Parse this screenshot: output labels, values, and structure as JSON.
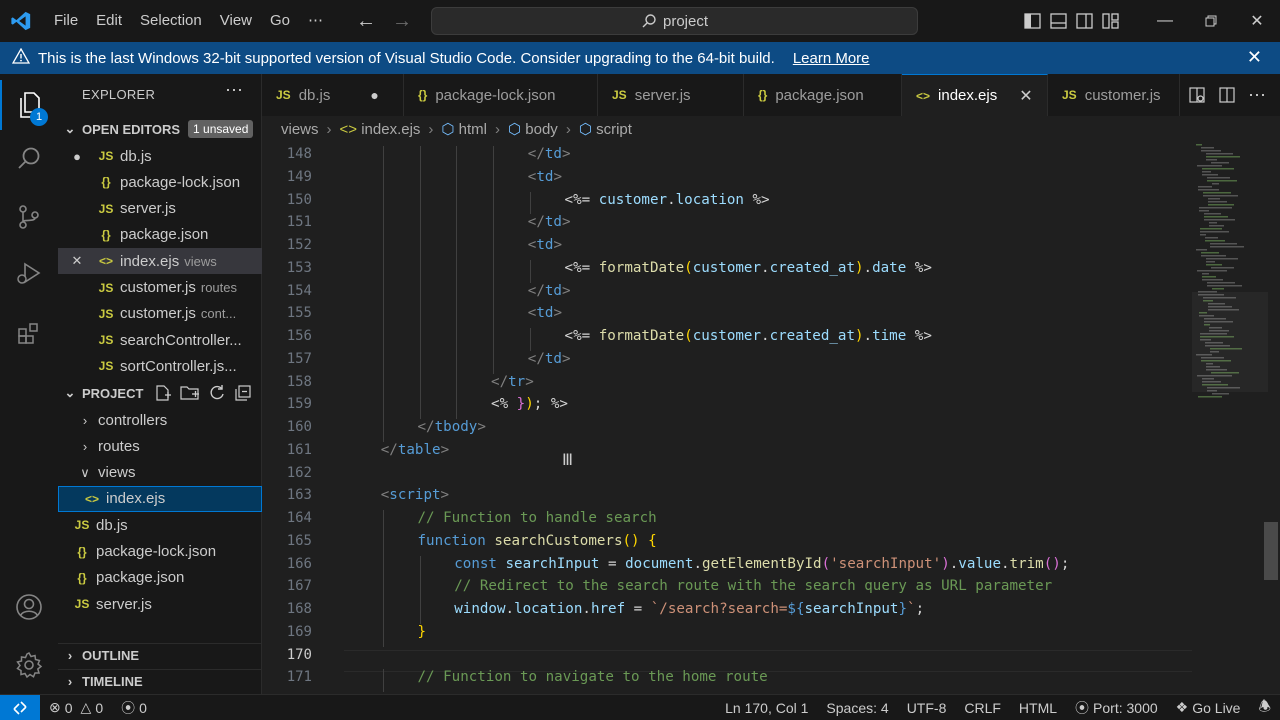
{
  "menu": [
    "File",
    "Edit",
    "Selection",
    "View",
    "Go",
    "⋯"
  ],
  "search": {
    "text": "project"
  },
  "banner": {
    "message": "This is the last Windows 32-bit supported version of Visual Studio Code. Consider upgrading to the 64-bit build.",
    "link": "Learn More"
  },
  "activity": {
    "badge": "1"
  },
  "explorer": {
    "title": "EXPLORER",
    "open_editors": {
      "title": "OPEN EDITORS",
      "badge": "1 unsaved",
      "items": [
        {
          "type": "JS",
          "name": "db.js",
          "desc": "",
          "modified": true
        },
        {
          "type": "{}",
          "name": "package-lock.json",
          "desc": ""
        },
        {
          "type": "JS",
          "name": "server.js",
          "desc": ""
        },
        {
          "type": "{}",
          "name": "package.json",
          "desc": ""
        },
        {
          "type": "<>",
          "name": "index.ejs",
          "desc": "views",
          "active": true
        },
        {
          "type": "JS",
          "name": "customer.js",
          "desc": "routes"
        },
        {
          "type": "JS",
          "name": "customer.js",
          "desc": "cont..."
        },
        {
          "type": "JS",
          "name": "searchController...",
          "desc": ""
        },
        {
          "type": "JS",
          "name": "sortController.js...",
          "desc": ""
        }
      ]
    },
    "project": {
      "title": "PROJECT",
      "items": [
        {
          "name": "controllers",
          "kind": "folder",
          "expanded": false
        },
        {
          "name": "routes",
          "kind": "folder",
          "expanded": false
        },
        {
          "name": "views",
          "kind": "folder",
          "expanded": true
        },
        {
          "name": "index.ejs",
          "kind": "file",
          "type": "<>",
          "selected": true
        },
        {
          "name": "db.js",
          "kind": "file",
          "type": "JS"
        },
        {
          "name": "package-lock.json",
          "kind": "file",
          "type": "{}"
        },
        {
          "name": "package.json",
          "kind": "file",
          "type": "{}"
        },
        {
          "name": "server.js",
          "kind": "file",
          "type": "JS"
        }
      ]
    },
    "outline": "OUTLINE",
    "timeline": "TIMELINE"
  },
  "tabs": [
    {
      "type": "JS",
      "name": "db.js",
      "modified": true
    },
    {
      "type": "{}",
      "name": "package-lock.json"
    },
    {
      "type": "JS",
      "name": "server.js"
    },
    {
      "type": "{}",
      "name": "package.json"
    },
    {
      "type": "<>",
      "name": "index.ejs",
      "active": true
    },
    {
      "type": "JS",
      "name": "customer.js"
    }
  ],
  "breadcrumb": [
    "views",
    "index.ejs",
    "html",
    "body",
    "script"
  ],
  "editor": {
    "current_line": 170,
    "lines": [
      {
        "n": 148,
        "i": 5,
        "tk": [
          [
            "t-tag",
            "</"
          ],
          [
            "t-name",
            "td"
          ],
          [
            "t-tag",
            ">"
          ]
        ]
      },
      {
        "n": 149,
        "i": 5,
        "tk": [
          [
            "t-tag",
            "<"
          ],
          [
            "t-name",
            "td"
          ],
          [
            "t-tag",
            ">"
          ]
        ]
      },
      {
        "n": 150,
        "i": 6,
        "tk": [
          [
            "t-d",
            "<%= "
          ],
          [
            "t-var",
            "customer"
          ],
          [
            "t-d",
            "."
          ],
          [
            "t-var",
            "location"
          ],
          [
            "t-d",
            " %>"
          ]
        ]
      },
      {
        "n": 151,
        "i": 5,
        "tk": [
          [
            "t-tag",
            "</"
          ],
          [
            "t-name",
            "td"
          ],
          [
            "t-tag",
            ">"
          ]
        ]
      },
      {
        "n": 152,
        "i": 5,
        "tk": [
          [
            "t-tag",
            "<"
          ],
          [
            "t-name",
            "td"
          ],
          [
            "t-tag",
            ">"
          ]
        ]
      },
      {
        "n": 153,
        "i": 6,
        "tk": [
          [
            "t-d",
            "<%= "
          ],
          [
            "t-fn",
            "formatDate"
          ],
          [
            "t-br1",
            "("
          ],
          [
            "t-var",
            "customer"
          ],
          [
            "t-d",
            "."
          ],
          [
            "t-var",
            "created_at"
          ],
          [
            "t-br1",
            ")"
          ],
          [
            "t-d",
            "."
          ],
          [
            "t-var",
            "date"
          ],
          [
            "t-d",
            " %>"
          ]
        ]
      },
      {
        "n": 154,
        "i": 5,
        "tk": [
          [
            "t-tag",
            "</"
          ],
          [
            "t-name",
            "td"
          ],
          [
            "t-tag",
            ">"
          ]
        ]
      },
      {
        "n": 155,
        "i": 5,
        "tk": [
          [
            "t-tag",
            "<"
          ],
          [
            "t-name",
            "td"
          ],
          [
            "t-tag",
            ">"
          ]
        ]
      },
      {
        "n": 156,
        "i": 6,
        "tk": [
          [
            "t-d",
            "<%= "
          ],
          [
            "t-fn",
            "formatDate"
          ],
          [
            "t-br1",
            "("
          ],
          [
            "t-var",
            "customer"
          ],
          [
            "t-d",
            "."
          ],
          [
            "t-var",
            "created_at"
          ],
          [
            "t-br1",
            ")"
          ],
          [
            "t-d",
            "."
          ],
          [
            "t-var",
            "time"
          ],
          [
            "t-d",
            " %>"
          ]
        ]
      },
      {
        "n": 157,
        "i": 5,
        "tk": [
          [
            "t-tag",
            "</"
          ],
          [
            "t-name",
            "td"
          ],
          [
            "t-tag",
            ">"
          ]
        ]
      },
      {
        "n": 158,
        "i": 4,
        "tk": [
          [
            "t-tag",
            "</"
          ],
          [
            "t-name",
            "tr"
          ],
          [
            "t-tag",
            ">"
          ]
        ]
      },
      {
        "n": 159,
        "i": 4,
        "tk": [
          [
            "t-d",
            "<% "
          ],
          [
            "t-br2",
            "}"
          ],
          [
            "t-br1",
            ")"
          ],
          [
            "t-d",
            "; %>"
          ]
        ]
      },
      {
        "n": 160,
        "i": 2,
        "tk": [
          [
            "t-tag",
            "</"
          ],
          [
            "t-name",
            "tbody"
          ],
          [
            "t-tag",
            ">"
          ]
        ]
      },
      {
        "n": 161,
        "i": 1,
        "tk": [
          [
            "t-tag",
            "</"
          ],
          [
            "t-name",
            "table"
          ],
          [
            "t-tag",
            ">"
          ]
        ]
      },
      {
        "n": 162,
        "i": 0,
        "tk": []
      },
      {
        "n": 163,
        "i": 1,
        "tk": [
          [
            "t-tag",
            "<"
          ],
          [
            "t-name",
            "script"
          ],
          [
            "t-tag",
            ">"
          ]
        ]
      },
      {
        "n": 164,
        "i": 2,
        "tk": [
          [
            "t-cm",
            "// Function to handle search"
          ]
        ]
      },
      {
        "n": 165,
        "i": 2,
        "tk": [
          [
            "t-kw",
            "function "
          ],
          [
            "t-fn",
            "searchCustomers"
          ],
          [
            "t-br1",
            "()"
          ],
          [
            "t-d",
            " "
          ],
          [
            "t-br1",
            "{"
          ]
        ]
      },
      {
        "n": 166,
        "i": 3,
        "tk": [
          [
            "t-kw",
            "const "
          ],
          [
            "t-var",
            "searchInput"
          ],
          [
            "t-d",
            " = "
          ],
          [
            "t-var",
            "document"
          ],
          [
            "t-d",
            "."
          ],
          [
            "t-fn",
            "getElementById"
          ],
          [
            "t-br2",
            "("
          ],
          [
            "t-str",
            "'searchInput'"
          ],
          [
            "t-br2",
            ")"
          ],
          [
            "t-d",
            "."
          ],
          [
            "t-var",
            "value"
          ],
          [
            "t-d",
            "."
          ],
          [
            "t-fn",
            "trim"
          ],
          [
            "t-br2",
            "()"
          ],
          [
            "t-d",
            ";"
          ]
        ]
      },
      {
        "n": 167,
        "i": 3,
        "tk": [
          [
            "t-cm",
            "// Redirect to the search route with the search query as URL parameter"
          ]
        ]
      },
      {
        "n": 168,
        "i": 3,
        "tk": [
          [
            "t-var",
            "window"
          ],
          [
            "t-d",
            "."
          ],
          [
            "t-var",
            "location"
          ],
          [
            "t-d",
            "."
          ],
          [
            "t-var",
            "href"
          ],
          [
            "t-d",
            " = "
          ],
          [
            "t-str",
            "`/search?search="
          ],
          [
            "t-kw",
            "${"
          ],
          [
            "t-var",
            "searchInput"
          ],
          [
            "t-kw",
            "}"
          ],
          [
            "t-str",
            "`"
          ],
          [
            "t-d",
            ";"
          ]
        ]
      },
      {
        "n": 169,
        "i": 2,
        "tk": [
          [
            "t-br1",
            "}"
          ]
        ]
      },
      {
        "n": 170,
        "i": 0,
        "tk": []
      },
      {
        "n": 171,
        "i": 2,
        "tk": [
          [
            "t-cm",
            "// Function to navigate to the home route"
          ]
        ]
      }
    ]
  },
  "status": {
    "errors": "0",
    "warnings": "0",
    "ports": "0",
    "position": "Ln 170, Col 1",
    "spaces": "Spaces: 4",
    "encoding": "UTF-8",
    "eol": "CRLF",
    "language": "HTML",
    "port": "Port: 3000",
    "golive": "Go Live"
  }
}
